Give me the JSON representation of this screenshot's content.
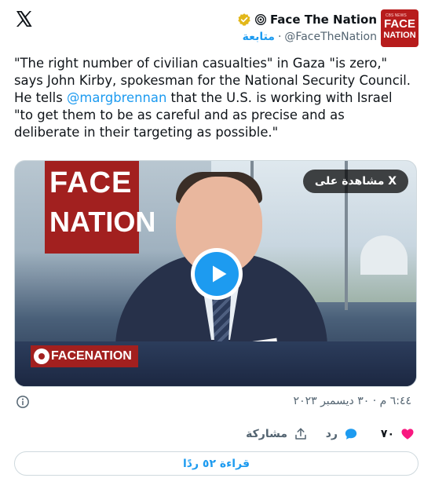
{
  "header": {
    "display_name": "Face The Nation",
    "handle": "@FaceTheNation",
    "separator": "·",
    "follow_label": "متابعة",
    "avatar": {
      "small_text": "CBS NEWS",
      "line1": "FACE",
      "line2": "NATION"
    },
    "icons": [
      "x-logo-icon",
      "verified-gold-icon",
      "broadcast-icon"
    ]
  },
  "tweet": {
    "text_before_mention": "\"The right number of civilian casualties\" in Gaza \"is zero,\" says John Kirby, spokesman for the National Security Council. He tells ",
    "mention": "@margbrennan",
    "text_after_mention": " that the U.S. is working with Israel \"to get them to be as careful and as precise and as deliberate in their targeting as possible.\""
  },
  "media": {
    "watch_label": "مشاهدة على X",
    "sign_line1": "FACE",
    "sign_line2": "NATION",
    "lower_third": "FACENATION",
    "colors": {
      "brand_red": "#a2201f",
      "play_blue": "#1d9bf0"
    }
  },
  "meta": {
    "timestamp": "٦:٤٤ م · ٣٠ ديسمبر ٢٠٢٣"
  },
  "actions": {
    "like_count": "٧٠",
    "reply_label": "رد",
    "share_label": "مشاركة"
  },
  "read_replies_label": "قراءة ٥٢ ردًا"
}
